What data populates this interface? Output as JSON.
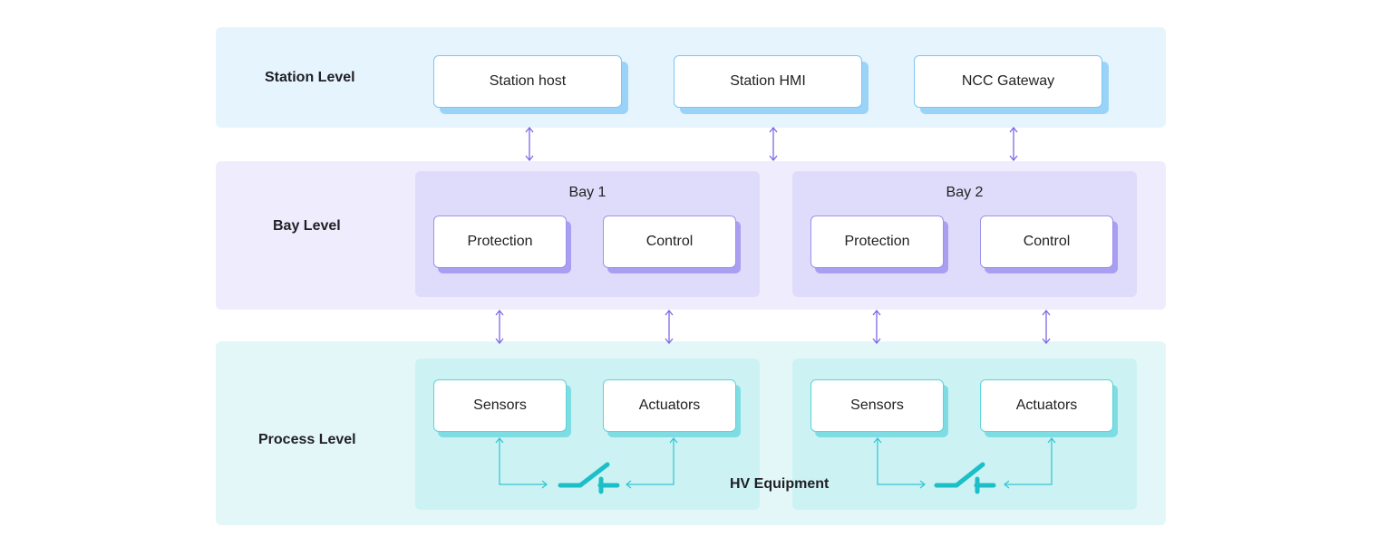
{
  "levels": {
    "station": {
      "label": "Station Level",
      "nodes": [
        "Station host",
        "Station HMI",
        "NCC Gateway"
      ]
    },
    "bay": {
      "label": "Bay Level",
      "groups": [
        {
          "title": "Bay 1",
          "nodes": [
            "Protection",
            "Control"
          ]
        },
        {
          "title": "Bay 2",
          "nodes": [
            "Protection",
            "Control"
          ]
        }
      ]
    },
    "process": {
      "label": "Process Level",
      "groups": [
        {
          "nodes": [
            "Sensors",
            "Actuators"
          ]
        },
        {
          "nodes": [
            "Sensors",
            "Actuators"
          ]
        }
      ],
      "equipment_label": "HV Equipment"
    }
  },
  "colors": {
    "station_band": "#e6f4fd",
    "bay_band": "#efedfd",
    "process_band": "#e3f7f8",
    "arrow_purple": "#7b68e6",
    "arrow_teal": "#2fc6cf",
    "switch_teal": "#1cbfc8"
  },
  "icons": {
    "switch": "hv-switch-icon",
    "bidirectional_arrow": "double-arrow-icon"
  }
}
